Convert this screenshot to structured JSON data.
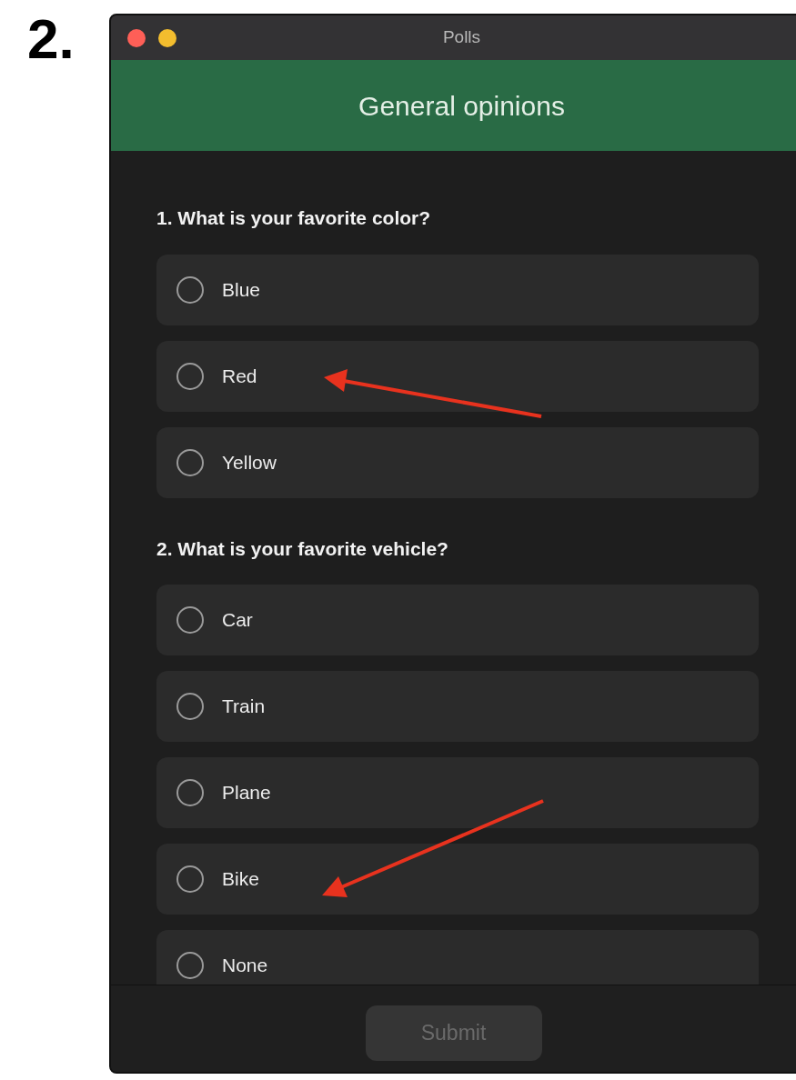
{
  "step_label": "2.",
  "window": {
    "title": "Polls"
  },
  "header": {
    "title": "General opinions"
  },
  "questions": [
    {
      "label": "1. What is your favorite color?",
      "options": [
        {
          "label": "Blue",
          "selected": false
        },
        {
          "label": "Red",
          "selected": false
        },
        {
          "label": "Yellow",
          "selected": false
        }
      ]
    },
    {
      "label": "2. What is your favorite vehicle?",
      "options": [
        {
          "label": "Car",
          "selected": false
        },
        {
          "label": "Train",
          "selected": false
        },
        {
          "label": "Plane",
          "selected": false
        },
        {
          "label": "Bike",
          "selected": false
        },
        {
          "label": "None",
          "selected": false
        }
      ]
    }
  ],
  "submit_button": {
    "label": "Submit",
    "disabled": true
  }
}
